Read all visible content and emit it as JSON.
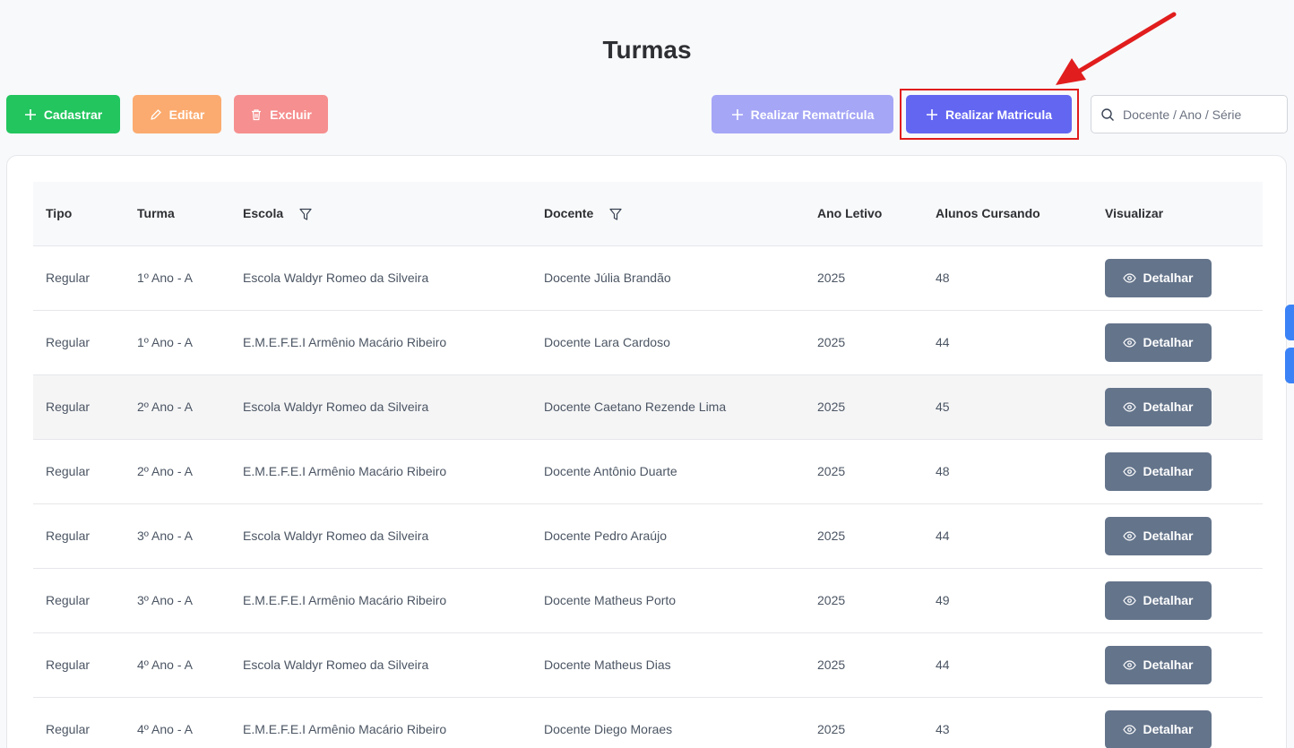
{
  "page": {
    "title": "Turmas"
  },
  "toolbar": {
    "cadastrar": "Cadastrar",
    "editar": "Editar",
    "excluir": "Excluir",
    "rematricula": "Realizar Rematrícula",
    "matricula": "Realizar Matricula"
  },
  "search": {
    "placeholder": "Docente / Ano / Série"
  },
  "table": {
    "headers": {
      "tipo": "Tipo",
      "turma": "Turma",
      "escola": "Escola",
      "docente": "Docente",
      "ano": "Ano Letivo",
      "alunos": "Alunos Cursando",
      "visualizar": "Visualizar"
    },
    "action_label": "Detalhar",
    "rows": [
      {
        "tipo": "Regular",
        "turma": "1º Ano - A",
        "escola": "Escola Waldyr Romeo da Silveira",
        "docente": "Docente Júlia Brandão",
        "ano": "2025",
        "alunos": "48"
      },
      {
        "tipo": "Regular",
        "turma": "1º Ano - A",
        "escola": "E.M.E.F.E.I Armênio Macário Ribeiro",
        "docente": "Docente Lara Cardoso",
        "ano": "2025",
        "alunos": "44"
      },
      {
        "tipo": "Regular",
        "turma": "2º Ano - A",
        "escola": "Escola Waldyr Romeo da Silveira",
        "docente": "Docente Caetano Rezende Lima",
        "ano": "2025",
        "alunos": "45"
      },
      {
        "tipo": "Regular",
        "turma": "2º Ano - A",
        "escola": "E.M.E.F.E.I Armênio Macário Ribeiro",
        "docente": "Docente Antônio Duarte",
        "ano": "2025",
        "alunos": "48"
      },
      {
        "tipo": "Regular",
        "turma": "3º Ano - A",
        "escola": "Escola Waldyr Romeo da Silveira",
        "docente": "Docente Pedro Araújo",
        "ano": "2025",
        "alunos": "44"
      },
      {
        "tipo": "Regular",
        "turma": "3º Ano - A",
        "escola": "E.M.E.F.E.I Armênio Macário Ribeiro",
        "docente": "Docente Matheus Porto",
        "ano": "2025",
        "alunos": "49"
      },
      {
        "tipo": "Regular",
        "turma": "4º Ano - A",
        "escola": "Escola Waldyr Romeo da Silveira",
        "docente": "Docente Matheus Dias",
        "ano": "2025",
        "alunos": "44"
      },
      {
        "tipo": "Regular",
        "turma": "4º Ano - A",
        "escola": "E.M.E.F.E.I Armênio Macário Ribeiro",
        "docente": "Docente Diego Moraes",
        "ano": "2025",
        "alunos": "43"
      }
    ]
  },
  "colors": {
    "cadastrar": "#22c55e",
    "editar": "#fbab6f",
    "excluir": "#f68f8f",
    "rematricula": "#a5a6f6",
    "matricula": "#6366f1",
    "detalhar": "#64748b",
    "highlight": "#e11d1d"
  },
  "icons": {
    "cadastrar": "plus-icon",
    "editar": "pencil-icon",
    "excluir": "trash-icon",
    "rematricula": "plus-icon",
    "matricula": "plus-icon",
    "search": "search-icon",
    "filter": "filter-icon",
    "detalhar": "eye-icon"
  }
}
